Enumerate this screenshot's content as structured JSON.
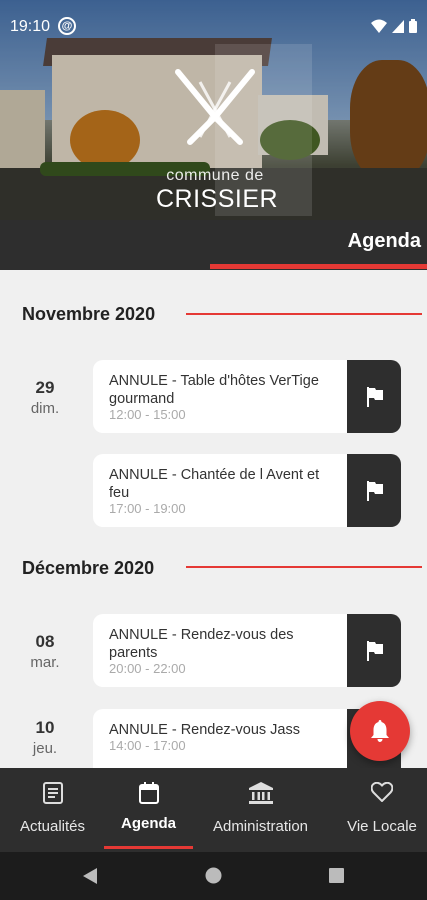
{
  "statusbar": {
    "time": "19:10"
  },
  "header": {
    "logo_line1": "commune de",
    "logo_line2": "CRISSIER"
  },
  "titlebar": {
    "title": "Agenda"
  },
  "months": [
    {
      "label": "Novembre 2020"
    },
    {
      "label": "Décembre 2020"
    }
  ],
  "events": [
    {
      "day": "29",
      "dow": "dim.",
      "title": "ANNULE - Table d'hôtes VerTige gourmand",
      "time": "12:00 - 15:00"
    },
    {
      "day": "",
      "dow": "",
      "title": "ANNULE - Chantée de l Avent et feu",
      "time": "17:00 - 19:00"
    },
    {
      "day": "08",
      "dow": "mar.",
      "title": "ANNULE - Rendez-vous des parents",
      "time": "20:00 - 22:00"
    },
    {
      "day": "10",
      "dow": "jeu.",
      "title": "ANNULE - Rendez-vous Jass",
      "time": "14:00 - 17:00"
    }
  ],
  "bottomnav": {
    "items": [
      {
        "label": "Actualités",
        "icon": "news-icon"
      },
      {
        "label": "Agenda",
        "icon": "calendar-icon",
        "active": true
      },
      {
        "label": "Administration",
        "icon": "bank-icon"
      },
      {
        "label": "Vie Locale",
        "icon": "heart-icon"
      }
    ]
  },
  "colors": {
    "accent": "#e53935",
    "dark": "#2e2e2e",
    "background": "#f0f0f0"
  }
}
